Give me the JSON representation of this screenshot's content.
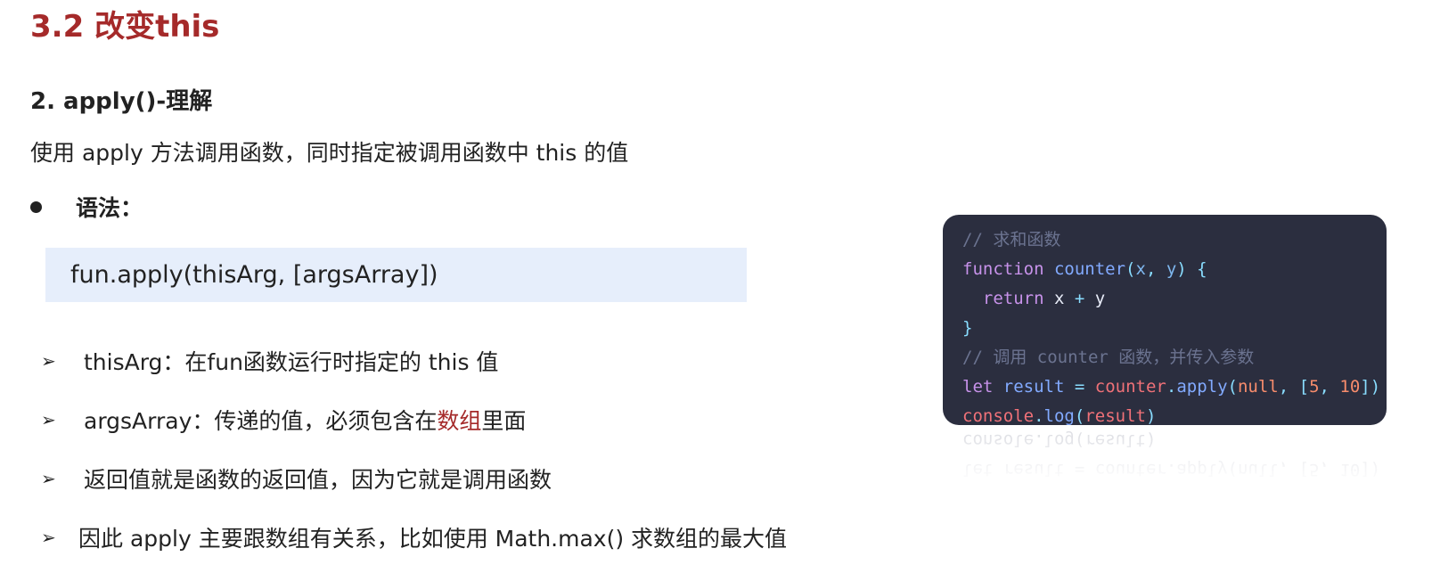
{
  "slide": {
    "title": "3.2 改变this"
  },
  "section": {
    "heading": "2. apply()-理解",
    "intro": "使用 apply 方法调用函数，同时指定被调用函数中 this 的值",
    "syntax_label": "语法：",
    "syntax_code": "fun.apply(thisArg, [argsArray])"
  },
  "points": [
    {
      "text": "thisArg：在fun函数运行时指定的 this 值"
    },
    {
      "before": "argsArray：传递的值，必须包含在",
      "highlight": "数组",
      "after": "里面"
    },
    {
      "text": "返回值就是函数的返回值，因为它就是调用函数"
    },
    {
      "text": "因此 apply 主要跟数组有关系，比如使用 Math.max() 求数组的最大值"
    }
  ],
  "code": {
    "comment1": "// 求和函数",
    "kw_function": "function",
    "fn_counter": "counter",
    "param_x": "x",
    "param_y": "y",
    "kw_return": "return",
    "var_x": "x",
    "var_y": "y",
    "op_plus": "+",
    "close_brace": "}",
    "comment2": "// 调用 counter 函数，并传入参数",
    "kw_let": "let",
    "var_result": "result",
    "op_eq": "=",
    "call_counter": "counter",
    "method_apply": "apply",
    "lit_null": "null",
    "num_5": "5",
    "num_10": "10",
    "obj_console": "console",
    "method_log": "log",
    "arg_result": "result"
  },
  "colors": {
    "accent": "#a52a2a",
    "syntax_bg": "#e6eefb",
    "code_bg": "#2b2e3f"
  }
}
